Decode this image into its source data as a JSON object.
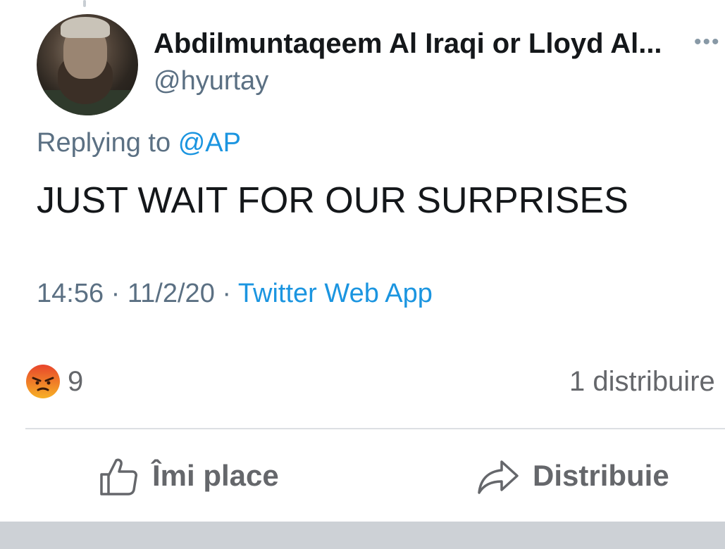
{
  "tweet": {
    "display_name": "Abdilmuntaqeem Al Iraqi or Lloyd Al...",
    "handle": "@hyurtay",
    "more_icon": "ellipsis-icon",
    "replying_prefix": "Replying to",
    "replying_mention": "@AP",
    "text": "JUST WAIT FOR OUR SURPRISES",
    "time_date": "14:56 · 11/2/20 · ",
    "source": "Twitter Web App"
  },
  "post": {
    "reaction_icon": "angry-reaction-icon",
    "reaction_count": "9",
    "shares_text": "1 distribuire",
    "actions": {
      "like_label": "Îmi place",
      "like_icon": "thumbs-up-icon",
      "share_label": "Distribuie",
      "share_icon": "share-arrow-icon"
    }
  },
  "colors": {
    "text_primary": "#14171a",
    "text_secondary": "#5b7083",
    "link_blue": "#1b95e0",
    "fb_gray": "#65676b",
    "angry_orange": "#f0643a"
  }
}
